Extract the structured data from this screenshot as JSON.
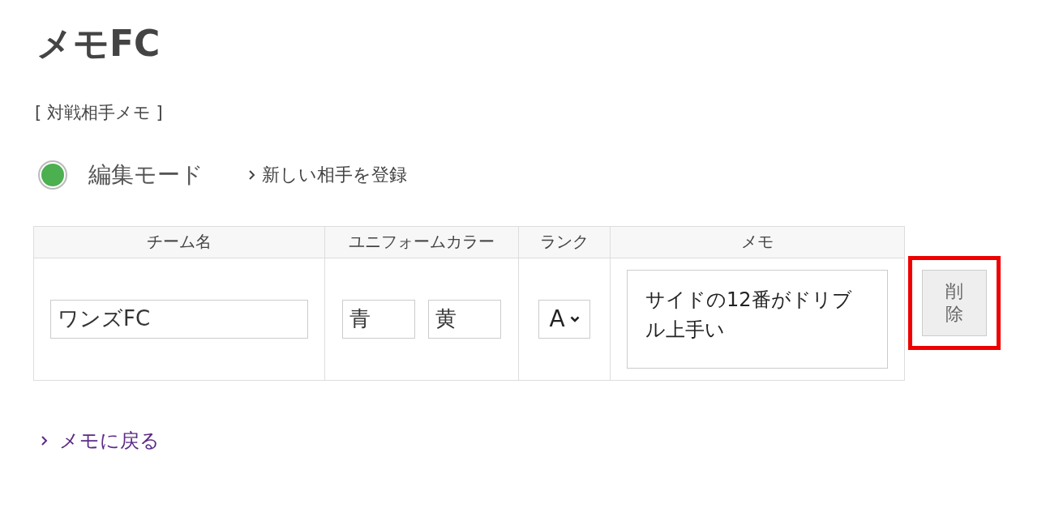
{
  "title": "メモFC",
  "section_label": "[ 対戦相手メモ ]",
  "edit_mode": {
    "label": "編集モード",
    "on": true
  },
  "register_link": "新しい相手を登録",
  "table": {
    "columns": [
      "チーム名",
      "ユニフォームカラー",
      "ランク",
      "メモ"
    ],
    "rows": [
      {
        "team_name": "ワンズFC",
        "colors": [
          "青",
          "黄"
        ],
        "rank": "A",
        "memo": "サイドの12番がドリブル上手い",
        "delete_button": {
          "label": "削除",
          "highlighted": true
        }
      }
    ]
  },
  "back_link": "メモに戻る"
}
